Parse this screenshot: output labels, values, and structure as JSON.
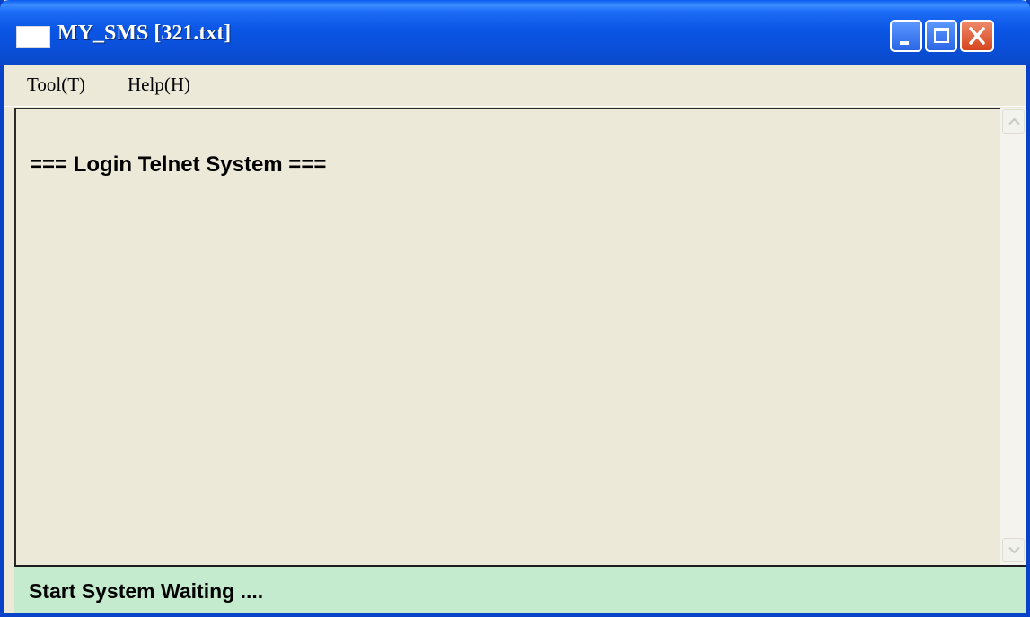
{
  "window": {
    "title": "MY_SMS [321.txt]",
    "title_bar_color": "#0B56E6",
    "close_button_color": "#D5441E"
  },
  "menu": {
    "items": [
      {
        "label": "Tool(T)"
      },
      {
        "label": "Help(H)"
      }
    ]
  },
  "content": {
    "text": "=== Login Telnet System ==="
  },
  "status": {
    "text": "Start System Waiting ....",
    "background_color": "#C5EBCF"
  },
  "icons": {
    "app": "app-icon",
    "minimize": "minimize-icon",
    "maximize": "maximize-icon",
    "close": "close-icon",
    "scroll_up": "chevron-up-icon",
    "scroll_down": "chevron-down-icon"
  }
}
